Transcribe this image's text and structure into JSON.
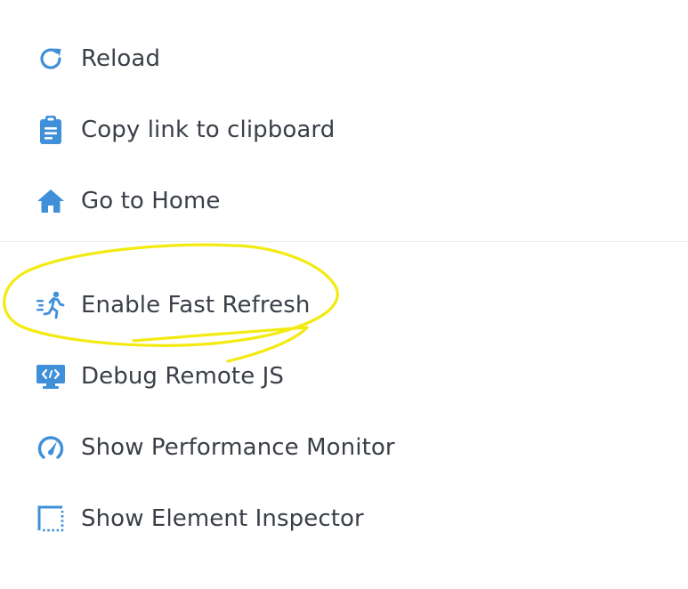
{
  "menu": {
    "items": [
      {
        "label": "Reload",
        "icon": "reload-icon"
      },
      {
        "label": "Copy link to clipboard",
        "icon": "clipboard-icon"
      },
      {
        "label": "Go to Home",
        "icon": "home-icon"
      },
      {
        "label": "Enable Fast Refresh",
        "icon": "running-person-icon"
      },
      {
        "label": "Debug Remote JS",
        "icon": "remote-debug-monitor-icon"
      },
      {
        "label": "Show Performance Monitor",
        "icon": "speedometer-icon"
      },
      {
        "label": "Show Element Inspector",
        "icon": "inspector-selection-icon"
      }
    ]
  },
  "colors": {
    "icon": "#3f8fd9",
    "text": "#3a3f47",
    "divider": "#ececec",
    "annotation": "#f3ea12"
  }
}
